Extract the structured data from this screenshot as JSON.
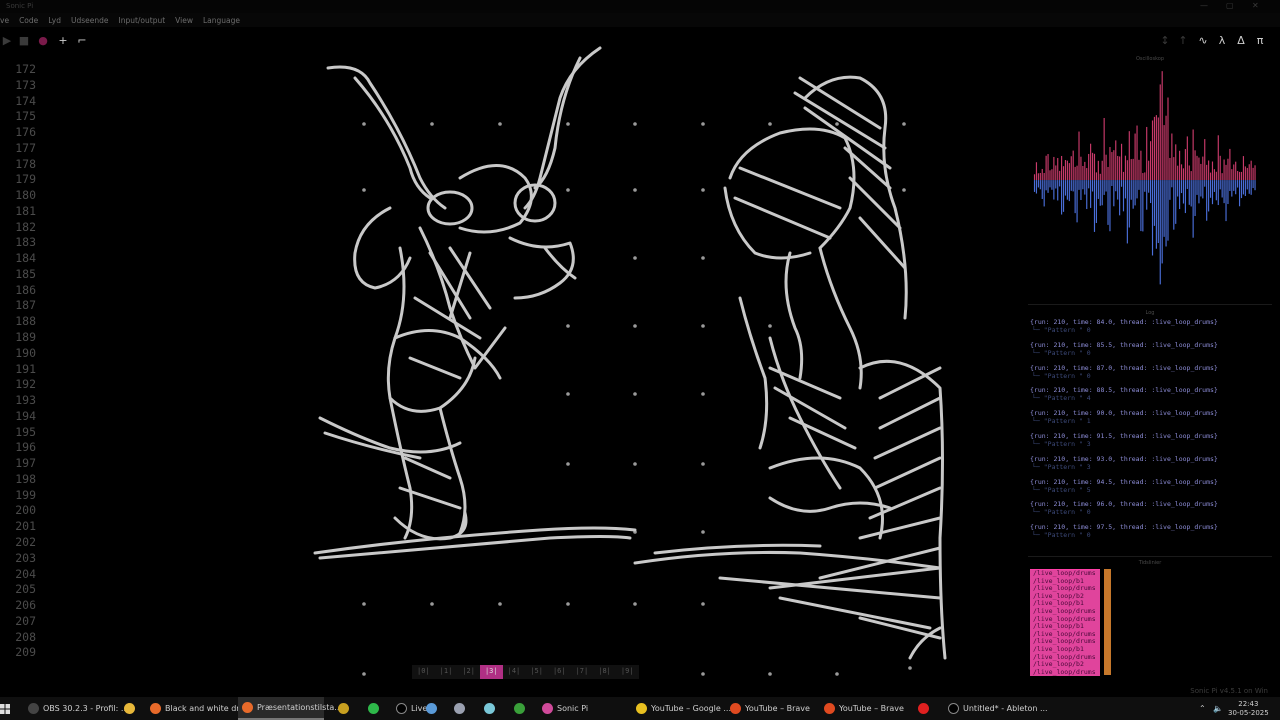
{
  "window": {
    "title": "Sonic Pi"
  },
  "menu": [
    "ve",
    "Code",
    "Lyd",
    "Udseende",
    "Input/output",
    "View",
    "Language"
  ],
  "editor": {
    "line_numbers": [
      "172",
      "173",
      "174",
      "175",
      "176",
      "177",
      "178",
      "179",
      "180",
      "181",
      "182",
      "183",
      "184",
      "185",
      "186",
      "187",
      "188",
      "189",
      "190",
      "191",
      "192",
      "193",
      "194",
      "195",
      "196",
      "197",
      "198",
      "199",
      "200",
      "201",
      "202",
      "203",
      "204",
      "205",
      "206",
      "207",
      "208",
      "209"
    ]
  },
  "scope": {
    "title": "Oscilloskop"
  },
  "log": {
    "title": "Log",
    "entries": [
      {
        "line": "{run: 210, time: 84.0, thread: :live_loop_drums}",
        "detail": " └─ \"Pattern \" 0"
      },
      {
        "line": "{run: 210, time: 85.5, thread: :live_loop_drums}",
        "detail": " └─ \"Pattern \" 0"
      },
      {
        "line": "{run: 210, time: 87.0, thread: :live_loop_drums}",
        "detail": " └─ \"Pattern \" 0"
      },
      {
        "line": "{run: 210, time: 88.5, thread: :live_loop_drums}",
        "detail": " └─ \"Pattern \" 4"
      },
      {
        "line": "{run: 210, time: 90.0, thread: :live_loop_drums}",
        "detail": " └─ \"Pattern \" 1"
      },
      {
        "line": "{run: 210, time: 91.5, thread: :live_loop_drums}",
        "detail": " └─ \"Pattern \" 3"
      },
      {
        "line": "{run: 210, time: 93.0, thread: :live_loop_drums}",
        "detail": " └─ \"Pattern \" 3"
      },
      {
        "line": "{run: 210, time: 94.5, thread: :live_loop_drums}",
        "detail": " └─ \"Pattern \" 5"
      },
      {
        "line": "{run: 210, time: 96.0, thread: :live_loop_drums}",
        "detail": " └─ \"Pattern \" 0"
      },
      {
        "line": "{run: 210, time: 97.5, thread: :live_loop_drums}",
        "detail": " └─ \"Pattern \" 0"
      }
    ]
  },
  "cues": {
    "title": "Tidslinier",
    "items": [
      "/live_loop/drums",
      "/live_loop/b1",
      "/live_loop/drums",
      "/live_loop/b2",
      "/live_loop/b1",
      "/live_loop/drums",
      "/live_loop/drums",
      "/live_loop/b1",
      "/live_loop/drums",
      "/live_loop/drums",
      "/live_loop/b1",
      "/live_loop/drums",
      "/live_loop/b2",
      "/live_loop/drums"
    ]
  },
  "buffers": [
    "|0|",
    "|1|",
    "|2|",
    "|3|",
    "|4|",
    "|5|",
    "|6|",
    "|7|",
    "|8|",
    "|9|"
  ],
  "buffers_active": 3,
  "status": {
    "version": "Sonic Pi v4.5.1 on Win"
  },
  "taskbar": {
    "items": [
      {
        "label": "OBS 30.2.3 - Profil: ...",
        "color": "#444444"
      },
      {
        "label": "",
        "color": "#e8b83a"
      },
      {
        "label": "Black and white dra...",
        "color": "#e86a2a"
      },
      {
        "label": "Præsentationstilsta...",
        "color": "#e86a2a"
      },
      {
        "label": "",
        "color": "#c8a020"
      },
      {
        "label": "",
        "color": "#2eb84a"
      },
      {
        "label": "Live",
        "color": "#000000"
      },
      {
        "label": "",
        "color": "#5a9ad8"
      },
      {
        "label": "",
        "color": "#9aa0b0"
      },
      {
        "label": "",
        "color": "#7ac8d8"
      },
      {
        "label": "",
        "color": "#3aa03a"
      },
      {
        "label": "Sonic Pi",
        "color": "#d04a9a"
      },
      {
        "label": "YouTube – Google ...",
        "color": "#e8c020"
      },
      {
        "label": "YouTube – Brave",
        "color": "#e04a20"
      },
      {
        "label": "YouTube – Brave",
        "color": "#e04a20"
      },
      {
        "label": "",
        "color": "#e02020"
      },
      {
        "label": "Untitled* - Ableton ...",
        "color": "#000000"
      }
    ],
    "time": "22:43",
    "date": "30-05-2025"
  }
}
